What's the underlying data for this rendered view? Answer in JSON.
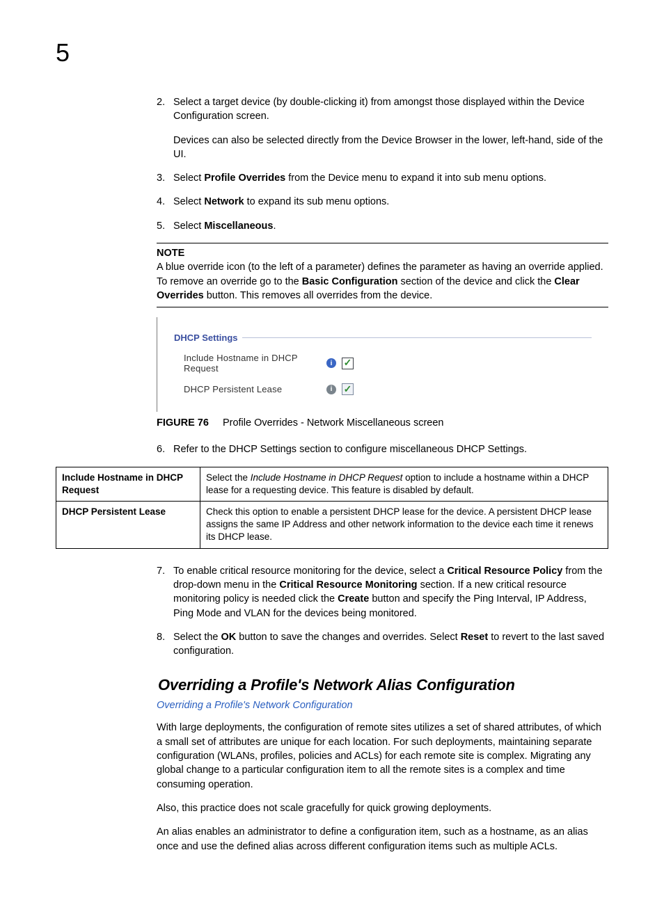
{
  "chapter_number": "5",
  "steps_a": [
    {
      "num": "2.",
      "paras": [
        "Select a target device (by double-clicking it) from amongst those displayed within the Device Configuration screen.",
        "Devices can also be selected directly from the Device Browser in the lower, left-hand, side of the UI."
      ]
    },
    {
      "num": "3.",
      "html": "Select <b>Profile Overrides</b> from the Device menu to expand it into sub menu options."
    },
    {
      "num": "4.",
      "html": "Select <b>Network</b> to expand its sub menu options."
    },
    {
      "num": "5.",
      "html": "Select <b>Miscellaneous</b>."
    }
  ],
  "note": {
    "label": "NOTE",
    "html": "A blue override icon (to the left of a parameter) defines the parameter as having an override applied. To remove an override go to the <b>Basic Configuration</b> section of the device and click the <b>Clear Overrides</b> button. This removes all overrides from the device."
  },
  "figure_shot": {
    "group_title": "DHCP Settings",
    "rows": [
      {
        "label": "Include Hostname in DHCP Request",
        "icon_variant": "blue",
        "checkbox_variant": "bold",
        "checked": true
      },
      {
        "label": "DHCP Persistent Lease",
        "icon_variant": "gray",
        "checkbox_variant": "plain",
        "checked": true
      }
    ]
  },
  "figure_caption": {
    "label": "FIGURE 76",
    "text": "Profile Overrides - Network Miscellaneous screen"
  },
  "steps_b": [
    {
      "num": "6.",
      "html": "Refer to the DHCP Settings section to configure miscellaneous DHCP Settings."
    }
  ],
  "def_table": [
    {
      "term": "Include Hostname in DHCP Request",
      "desc_html": "Select the <em>Include Hostname in DHCP Request</em> option to include a hostname within a DHCP lease for a requesting device. This feature is disabled by default."
    },
    {
      "term": "DHCP Persistent Lease",
      "desc_html": "Check this option to enable a persistent DHCP lease for the device. A persistent DHCP lease assigns the same IP Address and other network information to the device each time it renews its DHCP lease."
    }
  ],
  "steps_c": [
    {
      "num": "7.",
      "html": "To enable critical resource monitoring for the device, select a <b>Critical Resource Policy</b> from the drop-down menu in the <b>Critical Resource Monitoring</b> section. If a new critical resource monitoring policy is needed click the <b>Create</b> button and specify the Ping Interval, IP Address, Ping Mode and VLAN for the devices being monitored."
    },
    {
      "num": "8.",
      "html": "Select the <b>OK</b> button to save the changes and overrides. Select <b>Reset</b> to revert to the last saved configuration."
    }
  ],
  "section_heading": "Overriding a Profile's Network Alias Configuration",
  "breadcrumb_link": "Overriding a Profile's Network Configuration",
  "body_paras": [
    "With large deployments, the configuration of remote sites utilizes a set of shared attributes, of which a small set of attributes are unique for each location. For such deployments, maintaining separate configuration (WLANs, profiles, policies and ACLs) for each remote site is complex. Migrating any global change to a particular configuration item to all the remote sites is a complex and time consuming operation.",
    "Also, this practice does not scale gracefully for quick growing deployments.",
    "An alias enables an administrator to define a configuration item, such as a hostname, as an alias once and use the defined alias across different configuration items such as multiple ACLs."
  ]
}
